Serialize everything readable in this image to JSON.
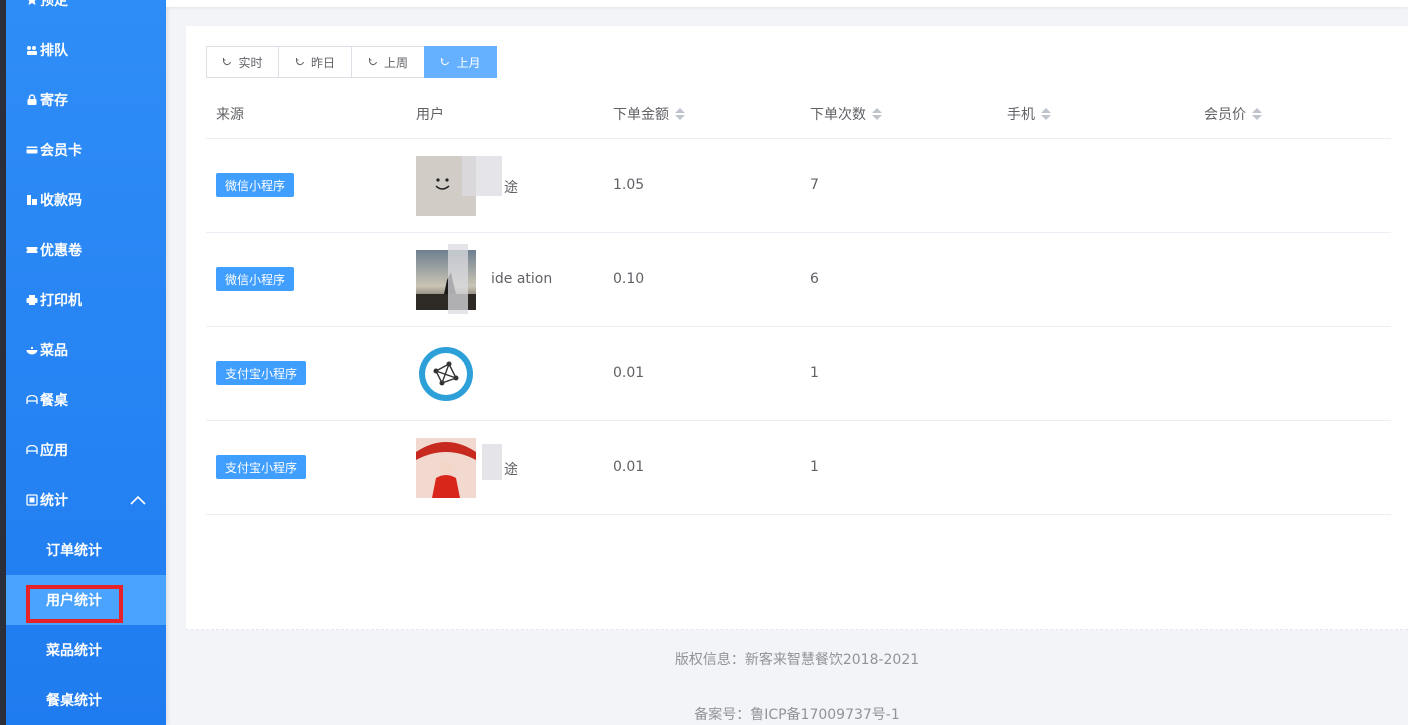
{
  "sidebar": {
    "items": [
      {
        "label": "预定",
        "icon": "star-icon"
      },
      {
        "label": "排队",
        "icon": "queue-icon"
      },
      {
        "label": "寄存",
        "icon": "lock-icon"
      },
      {
        "label": "会员卡",
        "icon": "card-icon"
      },
      {
        "label": "收款码",
        "icon": "qrcode-icon"
      },
      {
        "label": "优惠卷",
        "icon": "ticket-icon"
      },
      {
        "label": "打印机",
        "icon": "printer-icon"
      },
      {
        "label": "菜品",
        "icon": "dish-icon"
      },
      {
        "label": "餐桌",
        "icon": "table-icon"
      },
      {
        "label": "应用",
        "icon": "app-icon"
      },
      {
        "label": "统计",
        "icon": "stats-icon"
      }
    ],
    "sub_items": [
      {
        "label": "订单统计"
      },
      {
        "label": "用户统计"
      },
      {
        "label": "菜品统计"
      },
      {
        "label": "餐桌统计"
      }
    ]
  },
  "filters": {
    "buttons": [
      {
        "label": "实时"
      },
      {
        "label": "昨日"
      },
      {
        "label": "上周"
      },
      {
        "label": "上月"
      }
    ],
    "active_index": 3
  },
  "table": {
    "headers": [
      "来源",
      "用户",
      "下单金额",
      "下单次数",
      "手机",
      "会员价"
    ],
    "rows": [
      {
        "source": "微信小程序",
        "user": "途",
        "amount": "1.05",
        "count": "7",
        "phone": "",
        "member_price": ""
      },
      {
        "source": "微信小程序",
        "user": "ide  ation",
        "amount": "0.10",
        "count": "6",
        "phone": "",
        "member_price": ""
      },
      {
        "source": "支付宝小程序",
        "user": "",
        "amount": "0.01",
        "count": "1",
        "phone": "",
        "member_price": ""
      },
      {
        "source": "支付宝小程序",
        "user": "途",
        "amount": "0.01",
        "count": "1",
        "phone": "",
        "member_price": ""
      }
    ]
  },
  "footer": {
    "copyright": "版权信息：新客来智慧餐饮2018-2021",
    "icp": "备案号：鲁ICP备17009737号-1"
  },
  "colors": {
    "sidebar": "#2f8df7",
    "primary": "#409eff",
    "active_button": "#66b1ff",
    "highlight_box": "#e6212a"
  }
}
